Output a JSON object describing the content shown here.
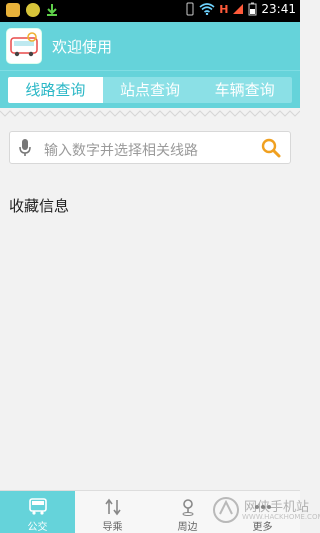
{
  "status_bar": {
    "time": "23:41",
    "network": "H",
    "icons": [
      "sms-icon",
      "app-icon",
      "download-icon",
      "vibrate-icon",
      "wifi-icon",
      "signal-icon",
      "battery-icon"
    ]
  },
  "header": {
    "title": "欢迎使用"
  },
  "tabs": [
    {
      "label": "线路查询",
      "active": true
    },
    {
      "label": "站点查询",
      "active": false
    },
    {
      "label": "车辆查询",
      "active": false
    }
  ],
  "search": {
    "placeholder": "输入数字并选择相关线路"
  },
  "favorites": {
    "title": "收藏信息"
  },
  "bottom_nav": [
    {
      "label": "公交",
      "icon": "bus-icon",
      "active": true
    },
    {
      "label": "导乘",
      "icon": "transfer-icon",
      "active": false
    },
    {
      "label": "周边",
      "icon": "location-pin-icon",
      "active": false
    },
    {
      "label": "更多",
      "icon": "more-icon",
      "active": false
    }
  ],
  "watermark": {
    "text": "网侠手机站",
    "url": "WWW.HACKHOME.COM"
  },
  "colors": {
    "accent": "#65d3da",
    "tab_active_text": "#2ab7c6"
  }
}
